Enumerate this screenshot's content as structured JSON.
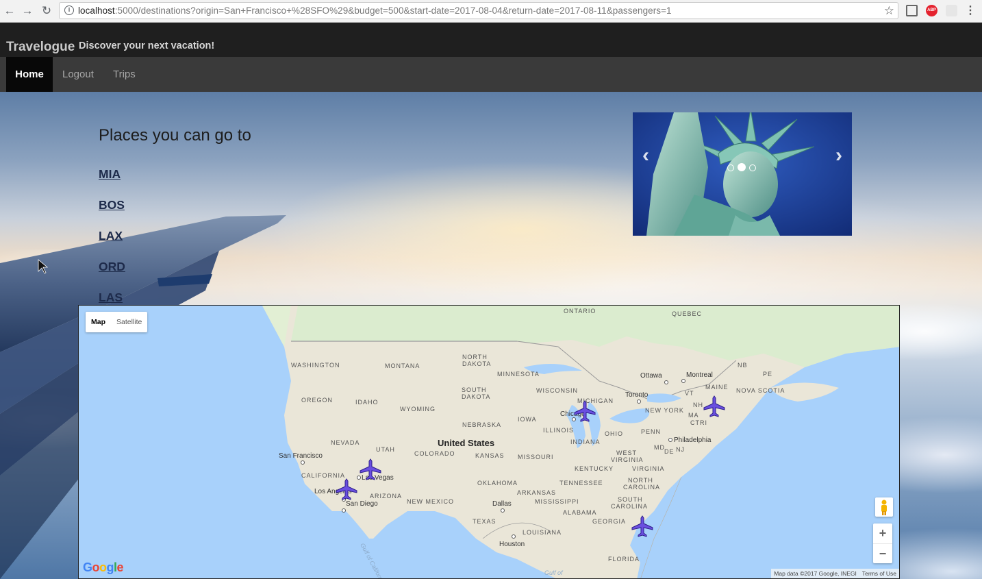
{
  "browser": {
    "url_host": "localhost",
    "url_path": ":5000/destinations?origin=San+Francisco+%28SFO%29&budget=500&start-date=2017-08-04&return-date=2017-08-11&passengers=1",
    "extensions": [
      "cast-icon",
      "adblock-plus-icon",
      "extension-icon"
    ],
    "abp_label": "ABP"
  },
  "header": {
    "brand": "Travelogue",
    "tagline": "Discover your next vacation!"
  },
  "nav": {
    "items": [
      {
        "label": "Home",
        "active": true
      },
      {
        "label": "Logout",
        "active": false
      },
      {
        "label": "Trips",
        "active": false
      }
    ]
  },
  "main": {
    "title": "Places you can go to",
    "destinations": [
      "MIA",
      "BOS",
      "LAX",
      "ORD",
      "LAS"
    ]
  },
  "carousel": {
    "slide_count": 3,
    "active_index": 1,
    "prev_icon": "chevron-left-icon",
    "next_icon": "chevron-right-icon"
  },
  "map": {
    "type_options": [
      "Map",
      "Satellite"
    ],
    "selected_type": "Map",
    "country_label": "United States",
    "region_labels": [
      "ONTARIO",
      "QUEBEC",
      "WASHINGTON",
      "MONTANA",
      "NORTH",
      "DAKOTA",
      "MINNESOTA",
      "NB",
      "PE",
      "WISCONSIN",
      "MAINE",
      "NOVA SCOTIA",
      "OREGON",
      "IDAHO",
      "SOUTH",
      "DAKOTA",
      "WYOMING",
      "MICHIGAN",
      "VT",
      "NH",
      "NEW YORK",
      "MA",
      "CT",
      "RI",
      "IOWA",
      "NEBRASKA",
      "ILLINOIS",
      "OHIO",
      "PENN",
      "NEVADA",
      "UTAH",
      "COLORADO",
      "KANSAS",
      "INDIANA",
      "MD",
      "DE",
      "NJ",
      "MISSOURI",
      "WEST",
      "VIRGINIA",
      "KENTUCKY",
      "VIRGINIA",
      "CALIFORNIA",
      "OKLAHOMA",
      "TENNESSEE",
      "NORTH",
      "CAROLINA",
      "ARIZONA",
      "NEW MEXICO",
      "ARKANSAS",
      "SOUTH",
      "CAROLINA",
      "MISSISSIPPI",
      "ALABAMA",
      "GEORGIA",
      "TEXAS",
      "LOUISIANA",
      "FLORIDA"
    ],
    "city_labels": [
      "Ottawa",
      "Montreal",
      "Toronto",
      "Chicago",
      "Philadelphia",
      "San Francisco",
      "Las Vegas",
      "Los Angeles",
      "San Diego",
      "Dallas",
      "Houston"
    ],
    "water_labels": [
      "Gulf of California",
      "Gulf of"
    ],
    "markers": [
      "MIA",
      "BOS",
      "LAX",
      "ORD",
      "LAS"
    ],
    "zoom_in": "+",
    "zoom_out": "−",
    "logo": "Google",
    "attribution": "Map data ©2017 Google, INEGI",
    "terms": "Terms of Use"
  }
}
